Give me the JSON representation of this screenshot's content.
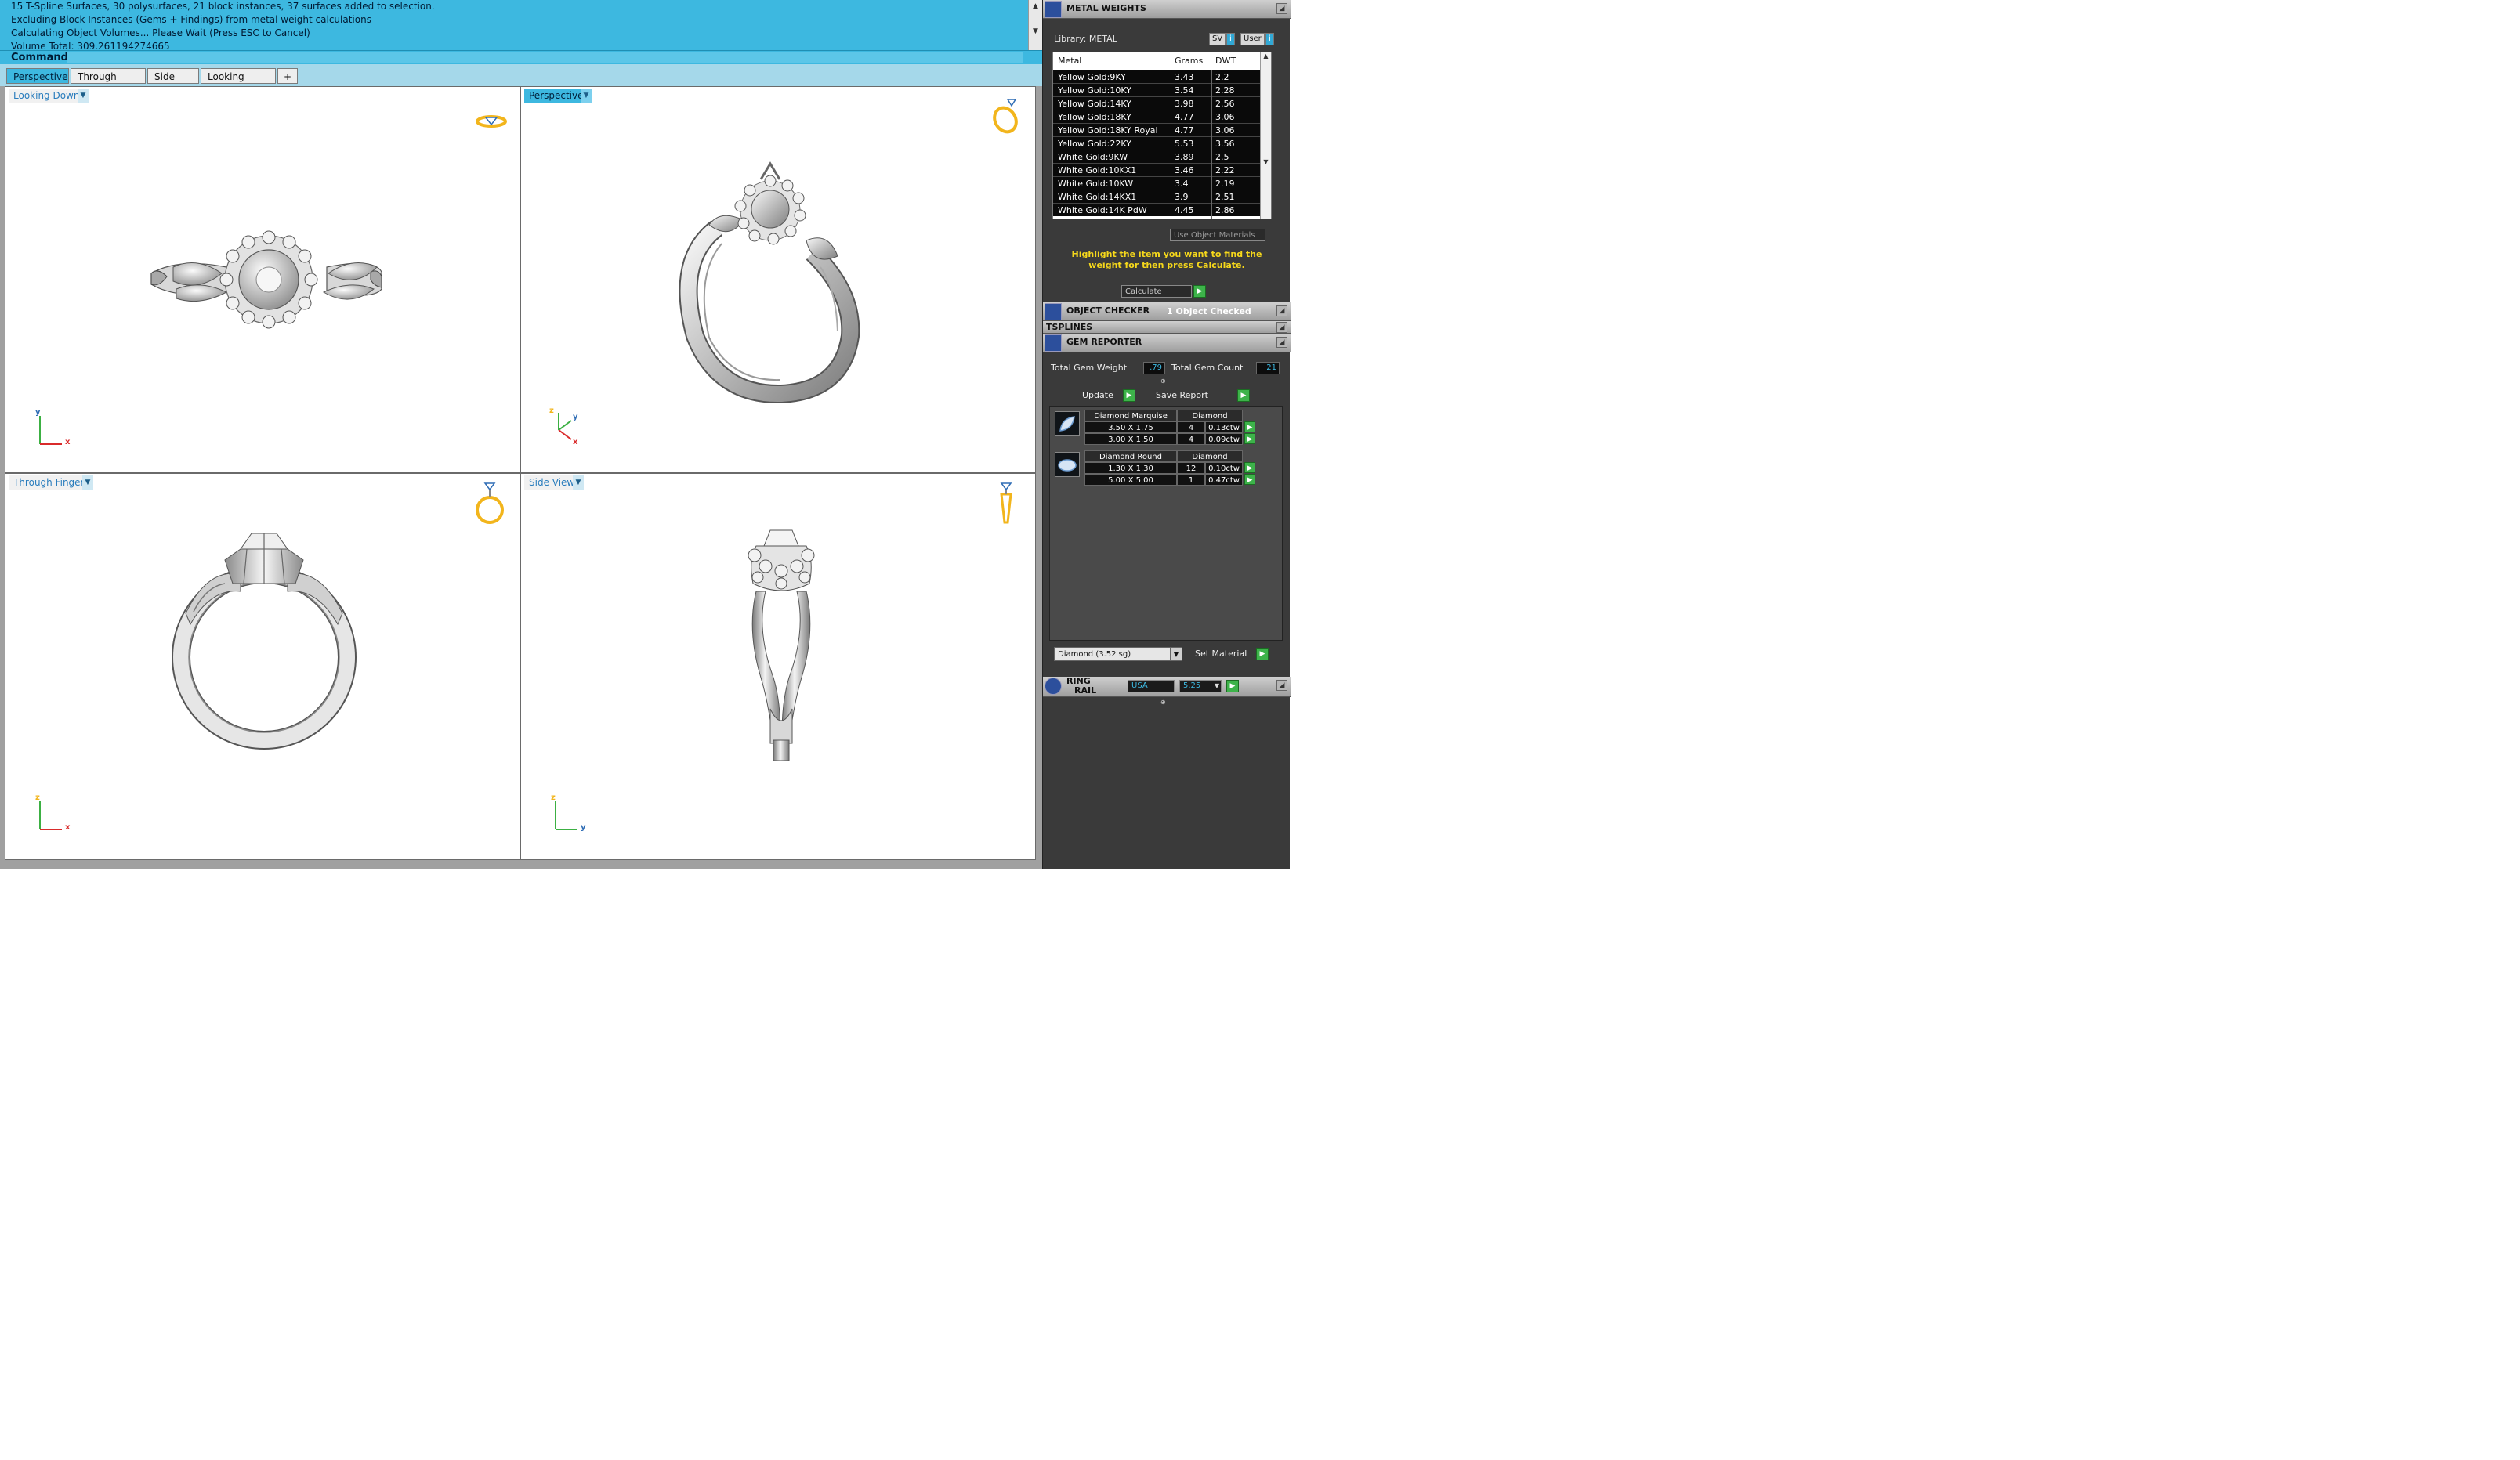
{
  "command": {
    "history": [
      "15 T-Spline Surfaces, 30 polysurfaces, 21 block instances, 37 surfaces added to selection.",
      "Excluding Block Instances (Gems + Findings) from metal weight calculations",
      "Calculating Object Volumes... Please Wait (Press ESC to Cancel)",
      "Volume Total: 309.261194274665"
    ],
    "prompt": "Command:"
  },
  "viewport_tabs": [
    "Perspective",
    "Through Finger",
    "Side View",
    "Looking Down",
    "+"
  ],
  "viewports": {
    "top_left": "Looking Down",
    "top_right": "Perspective",
    "bottom_left": "Through Finger",
    "bottom_right": "Side View"
  },
  "axes": {
    "x": "x",
    "y": "y",
    "z": "z"
  },
  "metal_weights": {
    "title": "METAL WEIGHTS",
    "library_label": "Library: METAL",
    "btn_sv": "SV",
    "btn_i1": "i",
    "btn_user": "User",
    "btn_i2": "i",
    "columns": [
      "Metal",
      "Grams",
      "DWT"
    ],
    "rows": [
      {
        "metal": "Yellow Gold:9KY",
        "grams": "3.43",
        "dwt": "2.2"
      },
      {
        "metal": "Yellow Gold:10KY",
        "grams": "3.54",
        "dwt": "2.28"
      },
      {
        "metal": "Yellow Gold:14KY",
        "grams": "3.98",
        "dwt": "2.56"
      },
      {
        "metal": "Yellow Gold:18KY",
        "grams": "4.77",
        "dwt": "3.06"
      },
      {
        "metal": "Yellow Gold:18KY Royal",
        "grams": "4.77",
        "dwt": "3.06"
      },
      {
        "metal": "Yellow Gold:22KY",
        "grams": "5.53",
        "dwt": "3.56"
      },
      {
        "metal": "White Gold:9KW",
        "grams": "3.89",
        "dwt": "2.5"
      },
      {
        "metal": "White Gold:10KX1",
        "grams": "3.46",
        "dwt": "2.22"
      },
      {
        "metal": "White Gold:10KW",
        "grams": "3.4",
        "dwt": "2.19"
      },
      {
        "metal": "White Gold:14KX1",
        "grams": "3.9",
        "dwt": "2.51"
      },
      {
        "metal": "White Gold:14K PdW",
        "grams": "4.45",
        "dwt": "2.86"
      }
    ],
    "use_object_materials": "Use Object Materials",
    "hint": "Highlight the item you want to find the weight for then press Calculate.",
    "calculate": "Calculate"
  },
  "object_checker": {
    "title": "OBJECT CHECKER",
    "status": "1 Object Checked"
  },
  "tsplines": {
    "title": "TSPLINES"
  },
  "gem_reporter": {
    "title": "GEM REPORTER",
    "total_weight_label": "Total Gem Weight",
    "total_weight": ".79",
    "total_count_label": "Total Gem Count",
    "total_count": "21",
    "update": "Update",
    "save_report": "Save Report",
    "groups": [
      {
        "cut": "Diamond Marquise",
        "material": "Diamond",
        "items": [
          {
            "size": "3.50 X 1.75",
            "qty": "4",
            "ctw": "0.13ctw"
          },
          {
            "size": "3.00 X 1.50",
            "qty": "4",
            "ctw": "0.09ctw"
          }
        ]
      },
      {
        "cut": "Diamond Round",
        "material": "Diamond",
        "items": [
          {
            "size": "1.30 X 1.30",
            "qty": "12",
            "ctw": "0.10ctw"
          },
          {
            "size": "5.00 X 5.00",
            "qty": "1",
            "ctw": "0.47ctw"
          }
        ]
      }
    ],
    "material_select": "Diamond     (3.52 sg)",
    "set_material": "Set Material"
  },
  "ring_rail": {
    "title_line1": "RING",
    "title_line2": "RAIL",
    "standard": "USA",
    "size": "5.25"
  },
  "colors": {
    "command_bg": "#3db8e0",
    "accent": "#3db8e0",
    "hint": "#f6d81b",
    "go_button": "#3db34a",
    "icon_gold": "#f2b51c"
  }
}
